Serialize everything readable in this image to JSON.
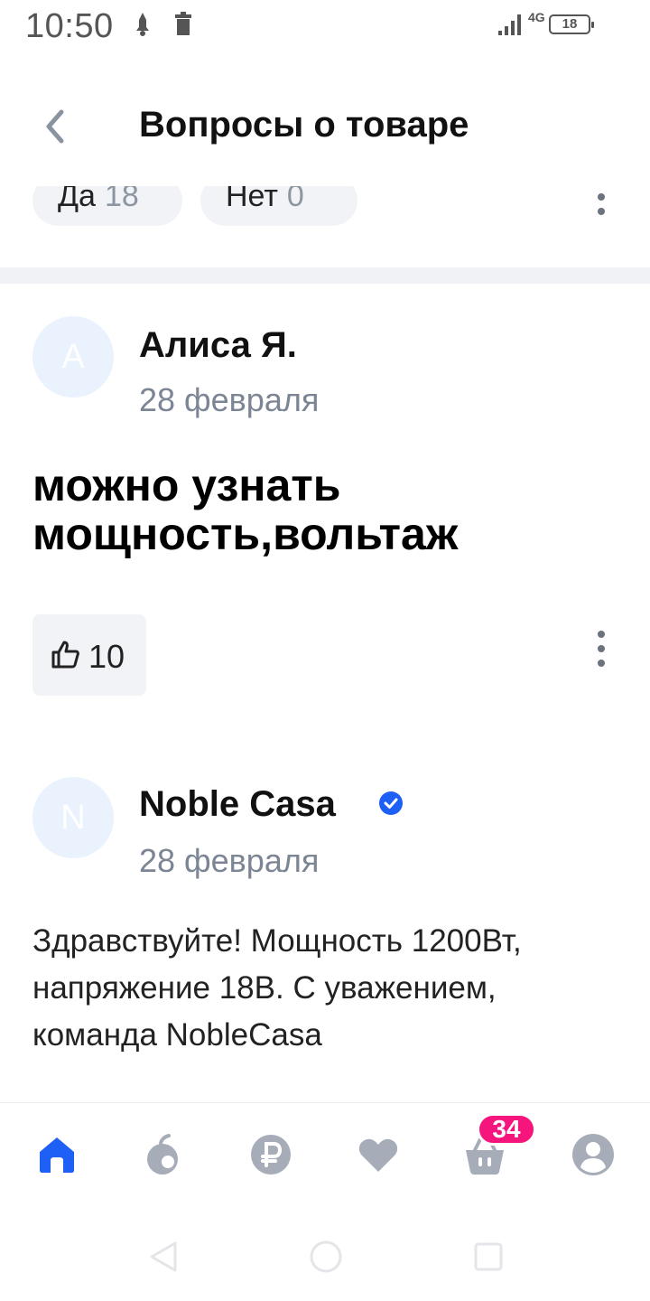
{
  "status_bar": {
    "time": "10:50",
    "network": "4G",
    "battery": "18"
  },
  "header": {
    "title": "Вопросы о товаре"
  },
  "chips": {
    "yes_label": "Да",
    "yes_count": "18",
    "no_label": "Нет",
    "no_count": "0"
  },
  "question": {
    "author_initial": "А",
    "author": "Алиса Я.",
    "date": "28 февраля",
    "text": "можно узнать мощность,вольтаж",
    "likes": "10"
  },
  "answer": {
    "author_initial": "N",
    "author": "Noble Casa",
    "date": "28 февраля",
    "text": "Здравствуйте! Мощность 1200Вт, напряжение 18В. С уважением, команда NobleCasa"
  },
  "bottom_nav": {
    "cart_count": "34",
    "items": [
      "home-icon",
      "catalog-icon",
      "ruble-icon",
      "heart-icon",
      "cart-icon",
      "profile-icon"
    ]
  },
  "colors": {
    "accent": "#1e5ff5",
    "badge": "#f5157c",
    "nav_inactive": "#a6adb8"
  }
}
